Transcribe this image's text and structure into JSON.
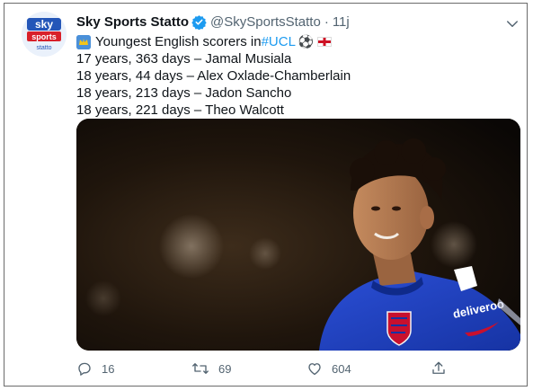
{
  "tweet": {
    "display_name": "Sky Sports Statto",
    "handle": "@SkySportsStatto",
    "separator": "·",
    "time": "11j",
    "lines": [
      {
        "pre": "Youngest English scorers in ",
        "hashtag": "#UCL"
      },
      {
        "text": "17 years, 363 days – Jamal Musiala"
      },
      {
        "text": "18 years, 44 days – Alex Oxlade-Chamberlain"
      },
      {
        "text": "18 years, 213 days – Jadon Sancho"
      },
      {
        "text": "18 years, 221 days – Theo Walcott"
      }
    ],
    "ball_emoji": "⚽"
  },
  "avatar": {
    "line1": "sky",
    "line2": "sports",
    "line3": "statto"
  },
  "media": {
    "kit_text": "deliveroo"
  },
  "actions": {
    "replies": "16",
    "retweets": "69",
    "likes": "604"
  },
  "icons": [
    "verified-badge-icon",
    "caret-down-icon",
    "crown-emoji-icon",
    "england-flag-icon",
    "reply-icon",
    "retweet-icon",
    "like-icon",
    "share-icon"
  ],
  "colors": {
    "link": "#1d9bf0",
    "muted": "#536471",
    "sky_red": "#d8202a",
    "kit_blue": "#1d3fbf"
  }
}
